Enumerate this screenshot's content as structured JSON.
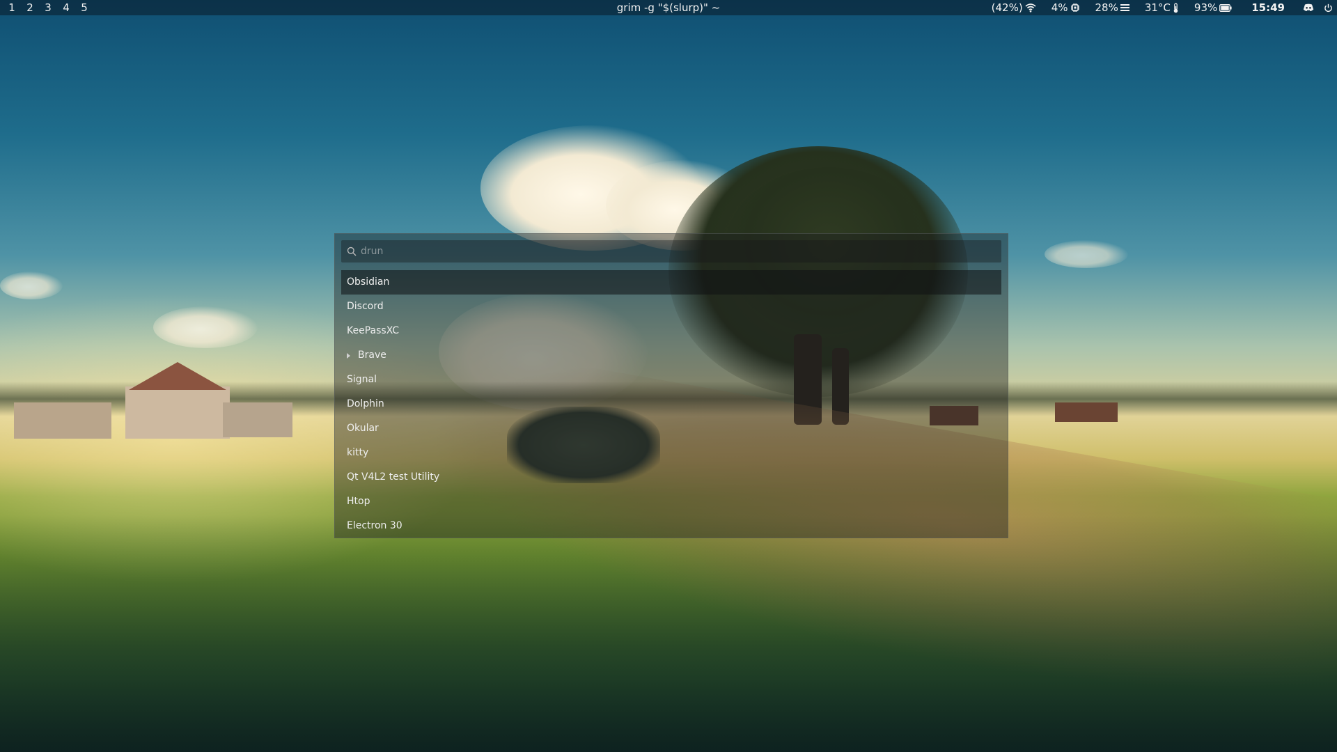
{
  "topbar": {
    "workspaces": [
      "1",
      "2",
      "3",
      "4",
      "5"
    ],
    "window_title": "grim -g \"$(slurp)\" ~",
    "network": {
      "text": "(42%)",
      "icon": "wifi-icon"
    },
    "cpu": {
      "text": "4%",
      "icon": "cpu-icon"
    },
    "memory": {
      "text": "28%",
      "icon": "memory-icon"
    },
    "temperature": {
      "text": "31°C",
      "icon": "thermometer-icon"
    },
    "battery": {
      "text": "93%",
      "icon": "battery-icon"
    },
    "clock": "15:49",
    "tray": [
      "discord-tray-icon"
    ],
    "power_icon": "power-icon"
  },
  "launcher": {
    "search_placeholder": "drun",
    "search_value": "",
    "selected_index": 0,
    "items": [
      {
        "label": "Obsidian"
      },
      {
        "label": "Discord"
      },
      {
        "label": "KeePassXC"
      },
      {
        "label": "Brave",
        "expandable": true
      },
      {
        "label": "Signal"
      },
      {
        "label": "Dolphin"
      },
      {
        "label": "Okular"
      },
      {
        "label": "kitty"
      },
      {
        "label": "Qt V4L2 test Utility"
      },
      {
        "label": "Htop"
      },
      {
        "label": "Electron 30"
      }
    ]
  },
  "colors": {
    "bar_background": "#0a2030",
    "launcher_background": "#1c1e1e",
    "selected_background": "#0e1012",
    "text": "#eeeeee"
  }
}
